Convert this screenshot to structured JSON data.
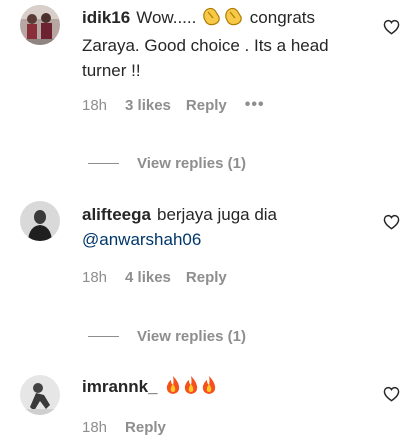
{
  "comments": [
    {
      "username": "idik16",
      "text_before_emoji": "Wow..... ",
      "emoji": "clapping-hands x2",
      "text_after_emoji": " congrats Zaraya. Good choice . Its a head turner !!",
      "time": "18h",
      "likes": "3 likes",
      "reply": "Reply",
      "more": "•••",
      "view_replies": "View replies (1)"
    },
    {
      "username": "alifteega",
      "text": "berjaya juga dia",
      "mention": "@anwarshah06",
      "time": "18h",
      "likes": "4 likes",
      "reply": "Reply",
      "view_replies": "View replies (1)"
    },
    {
      "username": "imrannk_",
      "emoji": "fire x3",
      "time": "18h",
      "reply": "Reply"
    }
  ],
  "icons": {
    "like": "heart-outline-icon",
    "more": "more-horizontal-icon"
  },
  "colors": {
    "text": "#262626",
    "secondary": "#8e8e8e",
    "mention": "#00376b"
  }
}
